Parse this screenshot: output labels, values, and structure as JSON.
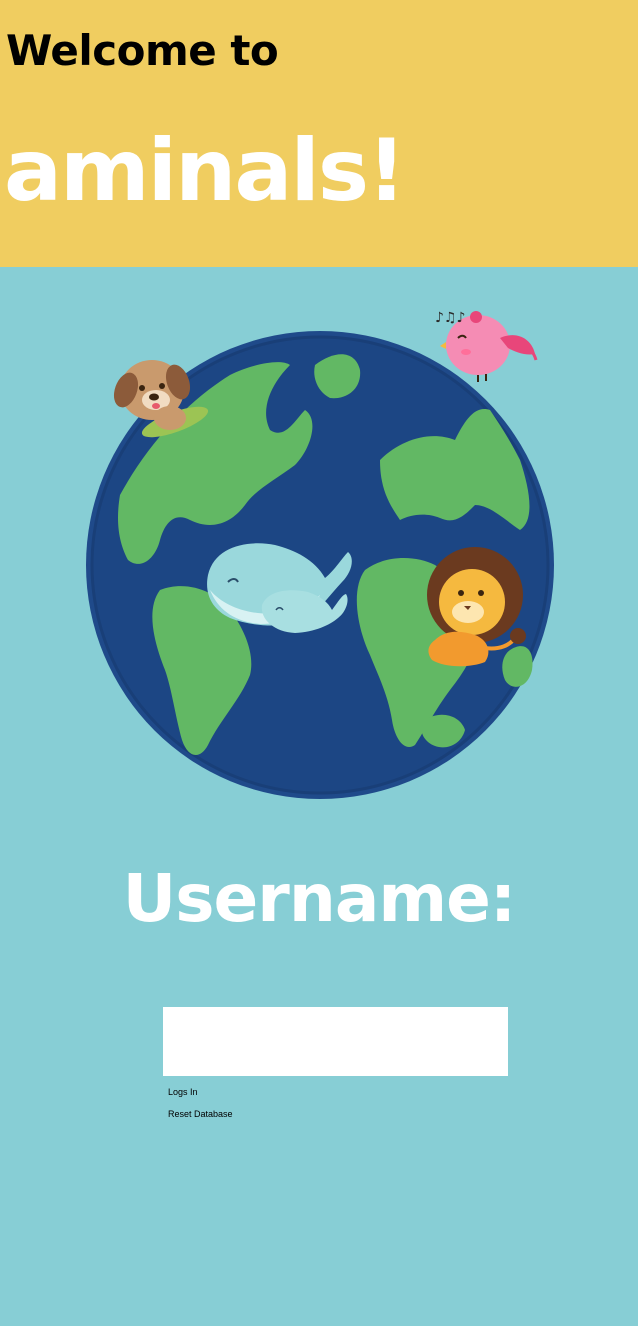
{
  "header": {
    "welcome_text": "Welcome to",
    "brand_name": "aminals!"
  },
  "hero": {
    "illustration": "earth-with-animals",
    "animals": [
      "puppy",
      "bird",
      "whale",
      "baby-whale",
      "lion"
    ]
  },
  "login": {
    "username_label": "Username:",
    "username_value": "",
    "username_placeholder": "",
    "login_button": "Logs In",
    "reset_button": "Reset Database"
  },
  "colors": {
    "header_bg": "#f0cd60",
    "page_bg": "#87ced5",
    "ocean": "#1f4a8a",
    "land": "#62b864"
  }
}
